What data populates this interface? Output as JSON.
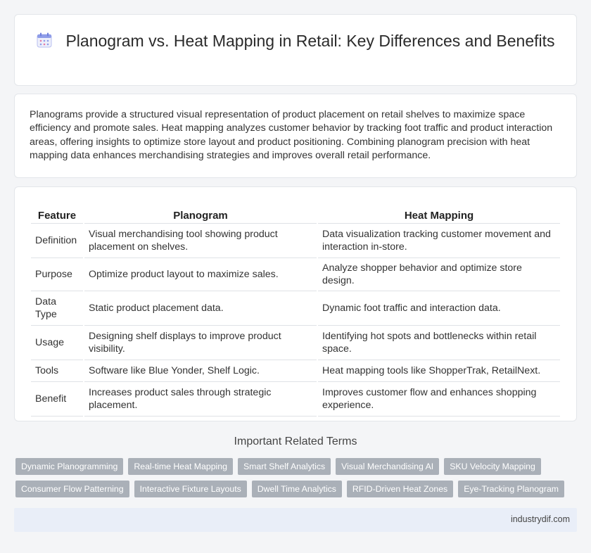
{
  "page": {
    "title": "Planogram vs. Heat Mapping in Retail: Key Differences and Benefits",
    "title_icon": "calendar-icon"
  },
  "intro": {
    "text": "Planograms provide a structured visual representation of product placement on retail shelves to maximize space efficiency and promote sales. Heat mapping analyzes customer behavior by tracking foot traffic and product interaction areas, offering insights to optimize store layout and product positioning. Combining planogram precision with heat mapping data enhances merchandising strategies and improves overall retail performance."
  },
  "table": {
    "headers": [
      "Feature",
      "Planogram",
      "Heat Mapping"
    ],
    "rows": [
      [
        "Definition",
        "Visual merchandising tool showing product placement on shelves.",
        "Data visualization tracking customer movement and interaction in-store."
      ],
      [
        "Purpose",
        "Optimize product layout to maximize sales.",
        "Analyze shopper behavior and optimize store design."
      ],
      [
        "Data Type",
        "Static product placement data.",
        "Dynamic foot traffic and interaction data."
      ],
      [
        "Usage",
        "Designing shelf displays to improve product visibility.",
        "Identifying hot spots and bottlenecks within retail space."
      ],
      [
        "Tools",
        "Software like Blue Yonder, Shelf Logic.",
        "Heat mapping tools like ShopperTrak, RetailNext."
      ],
      [
        "Benefit",
        "Increases product sales through strategic placement.",
        "Improves customer flow and enhances shopping experience."
      ]
    ]
  },
  "related": {
    "title": "Important Related Terms",
    "tags_row1": [
      "Dynamic Planogramming",
      "Real-time Heat Mapping",
      "Smart Shelf Analytics",
      "Visual Merchandising AI",
      "SKU Velocity Mapping"
    ],
    "tags_row2": [
      "Consumer Flow Patterning",
      "Interactive Fixture Layouts",
      "Dwell Time Analytics",
      "RFID-Driven Heat Zones",
      "Eye-Tracking Planogram"
    ]
  },
  "footer": {
    "site": "industrydif.com"
  },
  "colors": {
    "tag_bg": "#aab0b8",
    "footer_bg": "#e9eef8",
    "page_bg": "#f4f5f7"
  }
}
